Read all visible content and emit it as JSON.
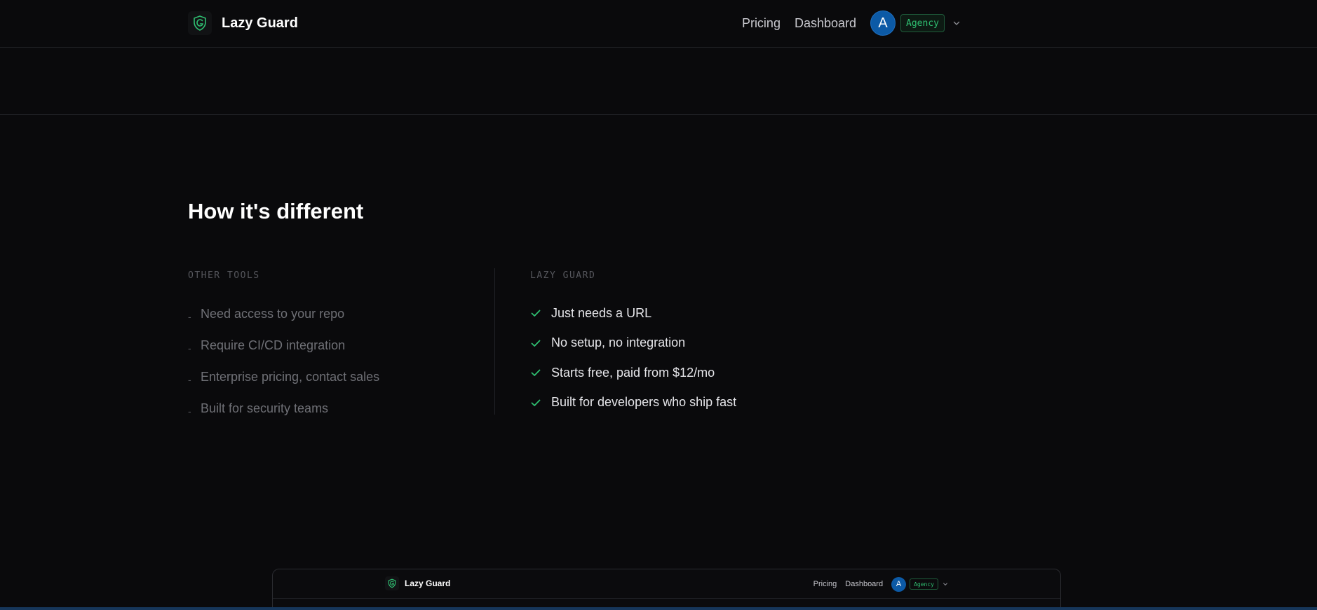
{
  "nav": {
    "brand": "Lazy Guard",
    "links": [
      "Pricing",
      "Dashboard"
    ],
    "avatar_initial": "A",
    "plan": "Agency",
    "logo_icon": "shield-g-icon",
    "menu_icon": "chevron-down-icon"
  },
  "section": {
    "title": "How it's different",
    "left_heading": "OTHER TOOLS",
    "left_items": [
      "Need access to your repo",
      "Require CI/CD integration",
      "Enterprise pricing, contact sales",
      "Built for security teams"
    ],
    "right_heading": "LAZY GUARD",
    "right_items": [
      "Just needs a URL",
      "No setup, no integration",
      "Starts free, paid from $12/mo",
      "Built for developers who ship fast"
    ],
    "bullet": "-",
    "check_icon": "check-icon"
  },
  "preview": {
    "brand": "Lazy Guard",
    "links": [
      "Pricing",
      "Dashboard"
    ],
    "avatar_initial": "A",
    "plan": "Agency"
  },
  "colors": {
    "background": "#0a0a0c",
    "accent_green": "#2fbf71",
    "avatar_blue": "#0c5aa6"
  }
}
